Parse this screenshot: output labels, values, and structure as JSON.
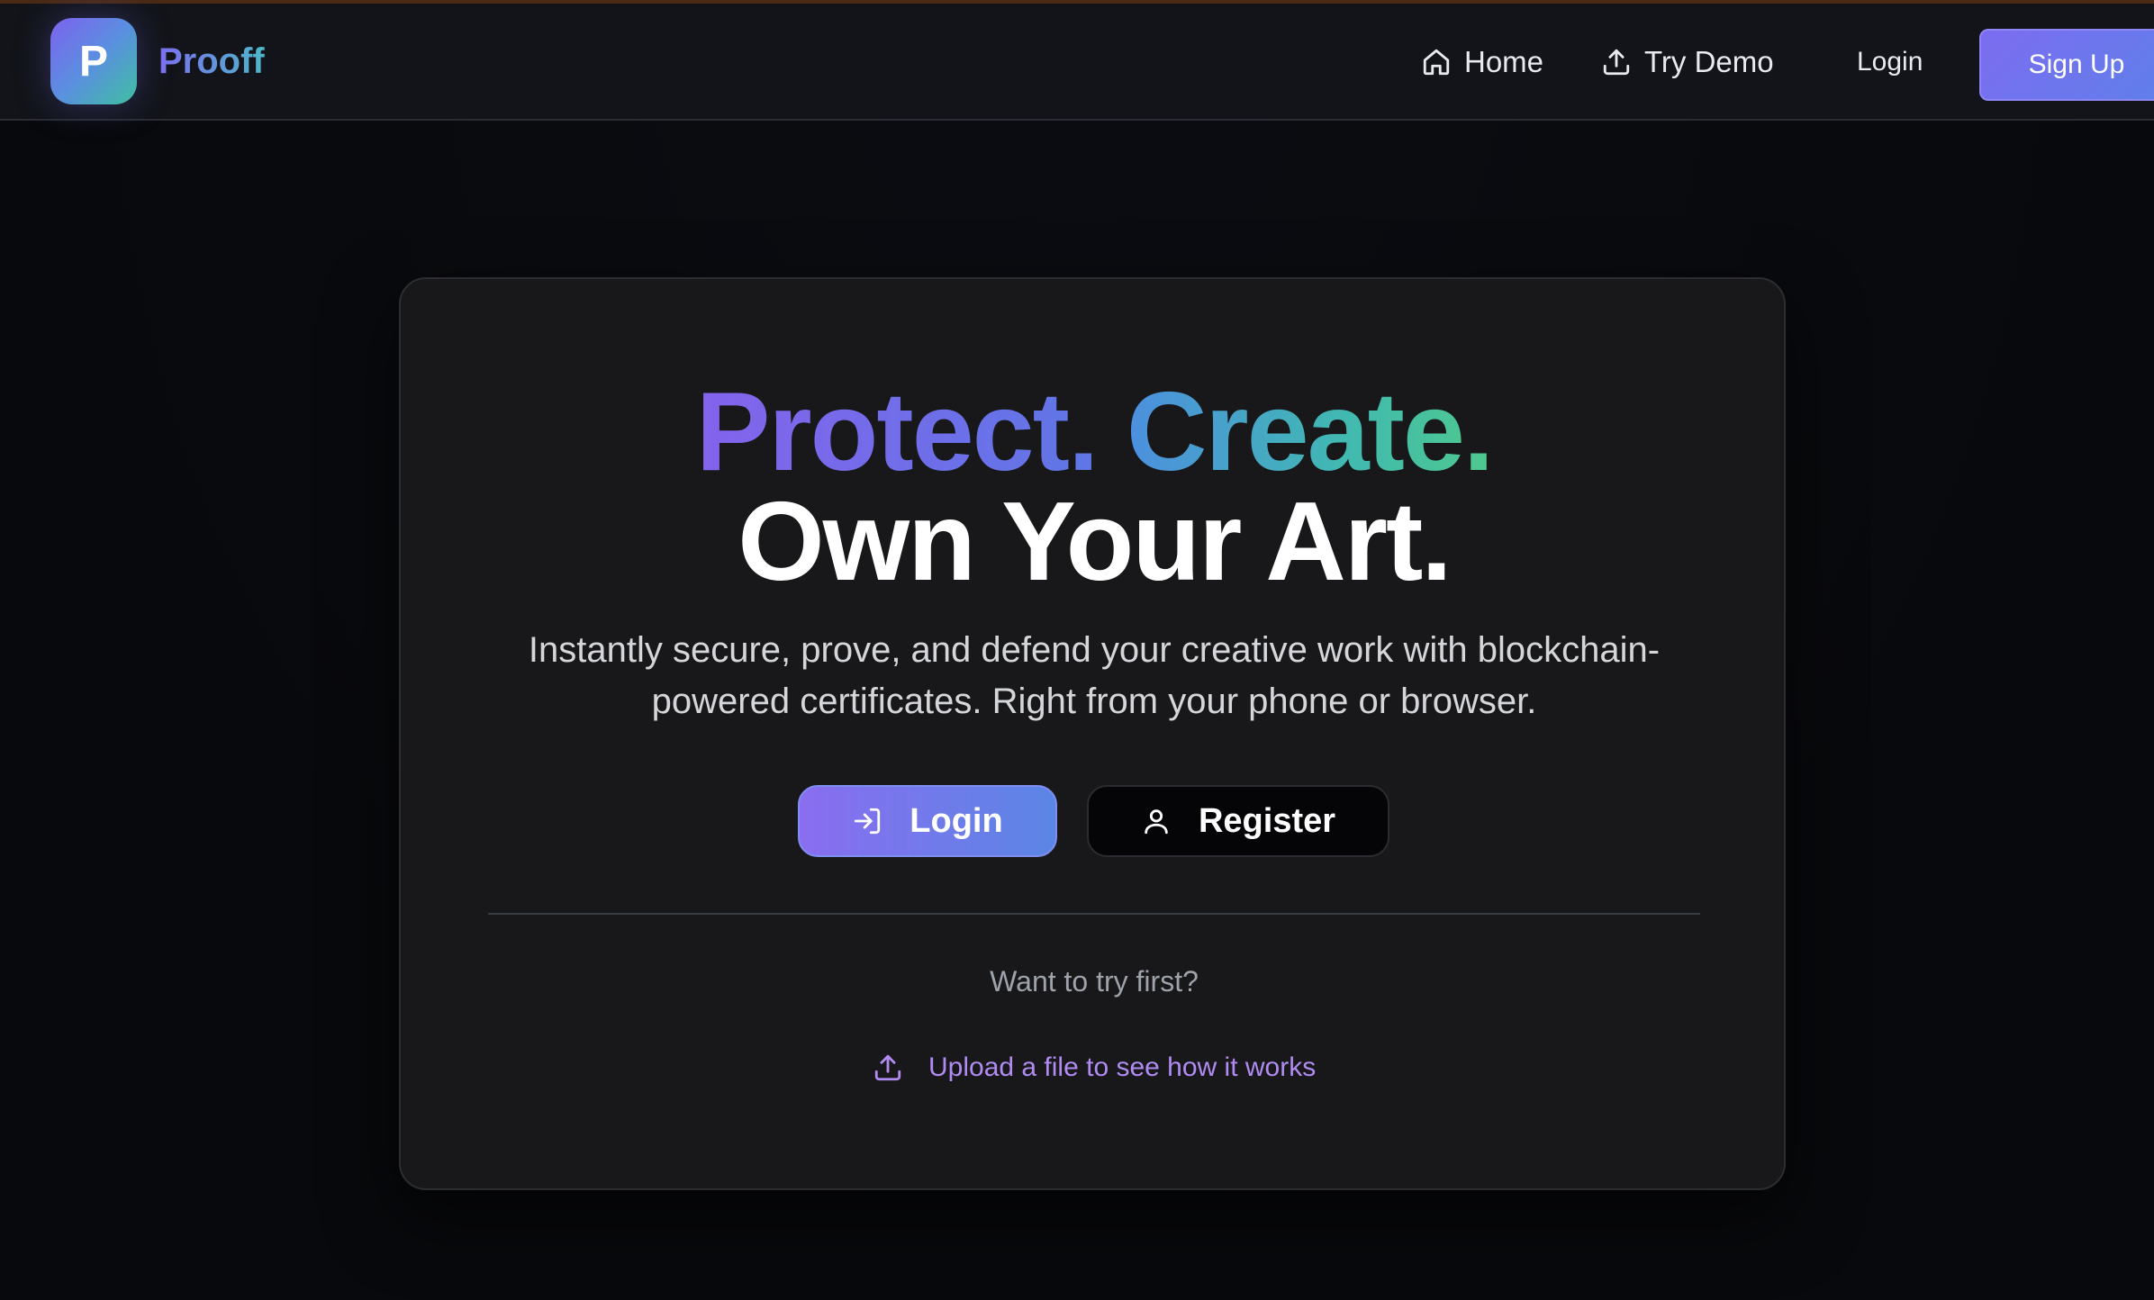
{
  "brand": {
    "logo_letter": "P",
    "name": "Prooff"
  },
  "nav": {
    "home_label": "Home",
    "home_icon": "home-icon",
    "demo_label": "Try Demo",
    "demo_icon": "upload-icon",
    "login_label": "Login",
    "signup_label": "Sign Up"
  },
  "hero": {
    "headline_part1": "Protect.",
    "headline_part2": "Create.",
    "headline_line2": "Own Your Art.",
    "subtitle": "Instantly secure, prove, and defend your creative work with blockchain-powered certificates. Right from your phone or browser.",
    "login_button": "Login",
    "login_icon": "login-arrow-icon",
    "register_button": "Register",
    "register_icon": "user-icon",
    "try_first": "Want to try first?",
    "upload_link": "Upload a file to see how it works",
    "upload_icon": "upload-icon"
  },
  "colors": {
    "accent_purple": "#7d6cf0",
    "accent_teal": "#41b9b1",
    "card_bg": "#18181a",
    "page_bg": "#08090c",
    "link": "#b08cf2"
  }
}
